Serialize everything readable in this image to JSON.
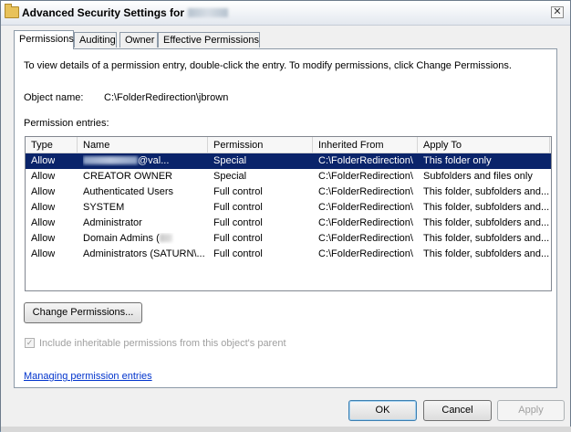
{
  "window": {
    "title": "Advanced Security Settings for",
    "close_glyph": "✕"
  },
  "tabs": [
    {
      "label": "Permissions",
      "active": true
    },
    {
      "label": "Auditing",
      "active": false
    },
    {
      "label": "Owner",
      "active": false
    },
    {
      "label": "Effective Permissions",
      "active": false
    }
  ],
  "info_text": "To view details of a permission entry, double-click the entry. To modify permissions, click Change Permissions.",
  "object": {
    "label": "Object name:",
    "value": "C:\\FolderRedirection\\jbrown"
  },
  "entries_label": "Permission entries:",
  "table": {
    "columns": [
      "Type",
      "Name",
      "Permission",
      "Inherited From",
      "Apply To"
    ],
    "rows": [
      {
        "type": "Allow",
        "name_suffix": "@val...",
        "permission": "Special",
        "inherited": "C:\\FolderRedirection\\",
        "apply_to": "This folder only",
        "selected": true
      },
      {
        "type": "Allow",
        "name": "CREATOR OWNER",
        "permission": "Special",
        "inherited": "C:\\FolderRedirection\\",
        "apply_to": "Subfolders and files only"
      },
      {
        "type": "Allow",
        "name": "Authenticated Users",
        "permission": "Full control",
        "inherited": "C:\\FolderRedirection\\",
        "apply_to": "This folder, subfolders and..."
      },
      {
        "type": "Allow",
        "name": "SYSTEM",
        "permission": "Full control",
        "inherited": "C:\\FolderRedirection\\",
        "apply_to": "This folder, subfolders and..."
      },
      {
        "type": "Allow",
        "name": "Administrator",
        "permission": "Full control",
        "inherited": "C:\\FolderRedirection\\",
        "apply_to": "This folder, subfolders and..."
      },
      {
        "type": "Allow",
        "name_prefix": "Domain Admins (",
        "permission": "Full control",
        "inherited": "C:\\FolderRedirection\\",
        "apply_to": "This folder, subfolders and..."
      },
      {
        "type": "Allow",
        "name": "Administrators (SATURN\\...",
        "permission": "Full control",
        "inherited": "C:\\FolderRedirection\\",
        "apply_to": "This folder, subfolders and..."
      }
    ]
  },
  "change_permissions_label": "Change Permissions...",
  "inherit_checkbox": {
    "label": "Include inheritable permissions from this object's parent",
    "checked": true
  },
  "help_link": "Managing permission entries",
  "buttons": {
    "ok": "OK",
    "cancel": "Cancel",
    "apply": "Apply"
  },
  "colors": {
    "selection": "#0a246a",
    "link": "#0033cc",
    "panel_border": "#8d9aa8"
  }
}
